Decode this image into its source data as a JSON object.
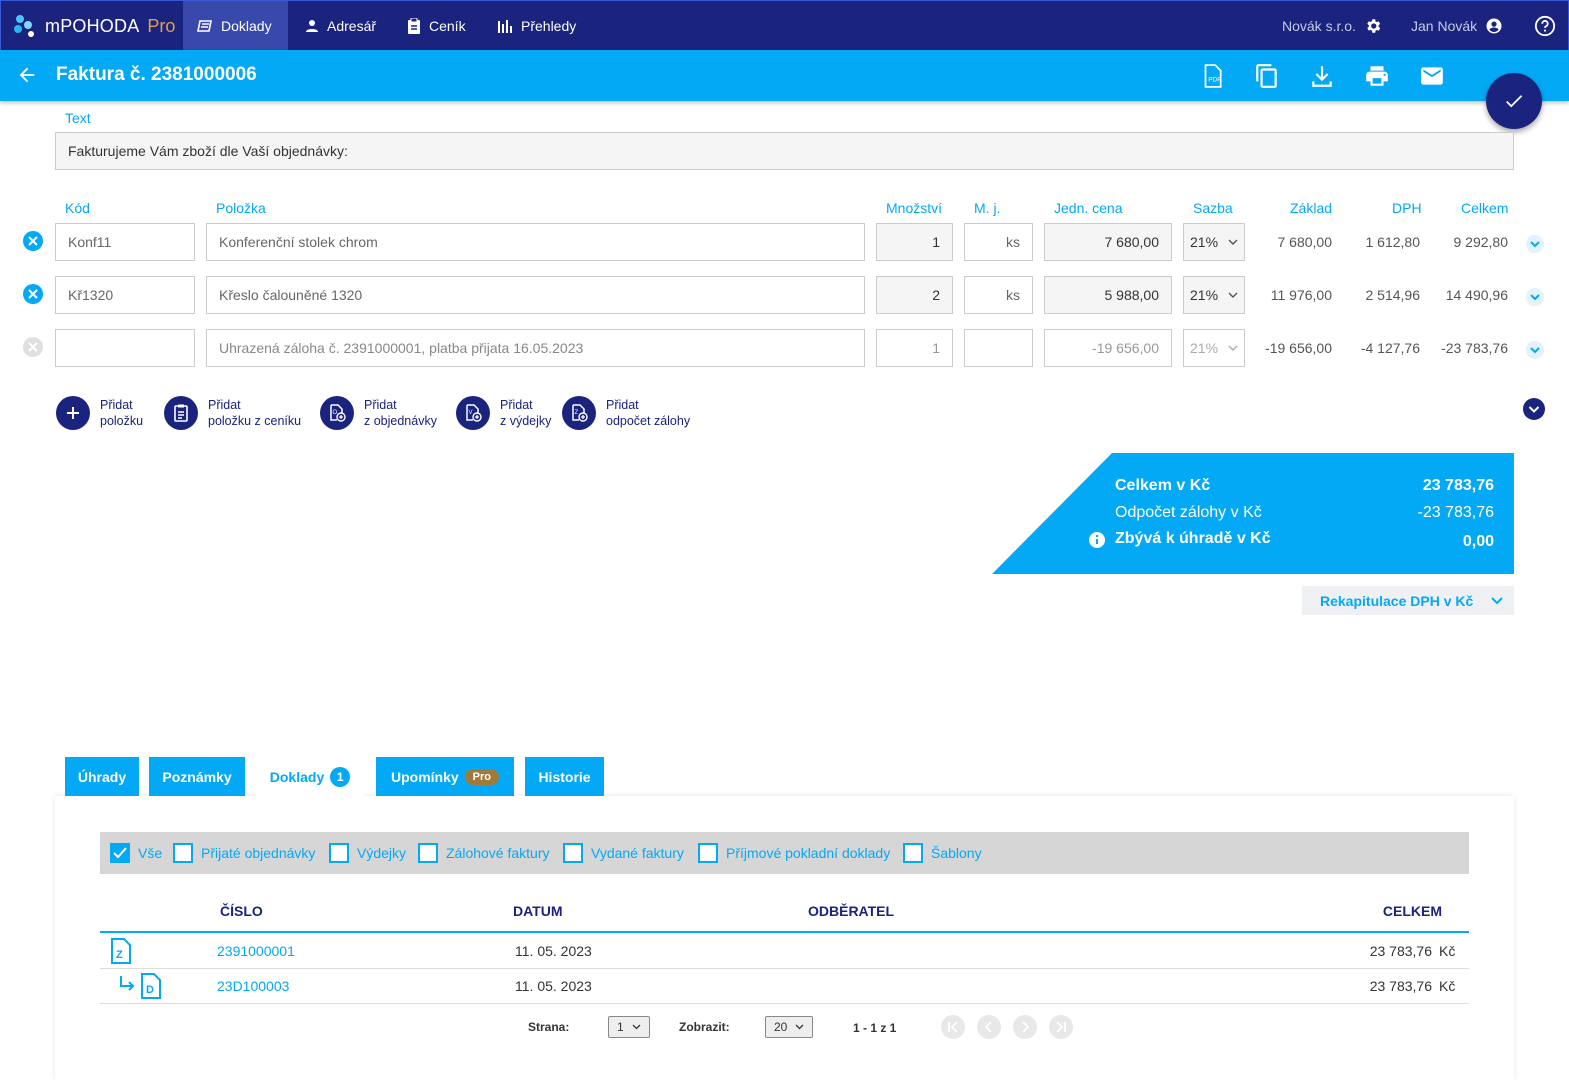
{
  "app": {
    "brand": "mPOHODA",
    "brand_suffix": "Pro"
  },
  "nav": {
    "items": [
      {
        "label": "Doklady",
        "icon": "stack-icon"
      },
      {
        "label": "Adresář",
        "icon": "person-icon"
      },
      {
        "label": "Ceník",
        "icon": "clipboard-icon"
      },
      {
        "label": "Přehledy",
        "icon": "bar-chart-icon"
      }
    ]
  },
  "account": {
    "company": "Novák s.r.o.",
    "user": "Jan Novák"
  },
  "titlebar": {
    "title": "Faktura č. 2381000006"
  },
  "text_field": {
    "label": "Text",
    "value": "Fakturujeme Vám zboží dle Vaší objednávky:"
  },
  "columns": {
    "kod": "Kód",
    "polozka": "Položka",
    "mnozstvi": "Množství",
    "mj": "M. j.",
    "cena": "Jedn. cena",
    "sazba": "Sazba",
    "zaklad": "Základ",
    "dph": "DPH",
    "celkem": "Celkem"
  },
  "rows": [
    {
      "kod": "Konf11",
      "polozka": "Konferenční stolek chrom",
      "mnozstvi": "1",
      "mj": "ks",
      "cena": "7 680,00",
      "sazba": "21%",
      "zaklad": "7 680,00",
      "dph": "1 612,80",
      "celkem": "9 292,80"
    },
    {
      "kod": "Kř1320",
      "polozka": "Křeslo čalouněné 1320",
      "mnozstvi": "2",
      "mj": "ks",
      "cena": "5 988,00",
      "sazba": "21%",
      "zaklad": "11 976,00",
      "dph": "2 514,96",
      "celkem": "14 490,96"
    },
    {
      "kod": "",
      "polozka": "Uhrazená záloha č. 2391000001, platba přijata 16.05.2023",
      "mnozstvi": "1",
      "mj": "",
      "cena": "-19 656,00",
      "sazba": "21%",
      "zaklad": "-19 656,00",
      "dph": "-4 127,76",
      "celkem": "-23 783,76"
    }
  ],
  "add_buttons": [
    {
      "line1": "Přidat",
      "line2": "položku"
    },
    {
      "line1": "Přidat",
      "line2": "položku z ceníku"
    },
    {
      "line1": "Přidat",
      "line2": "z objednávky"
    },
    {
      "line1": "Přidat",
      "line2": "z výdejky"
    },
    {
      "line1": "Přidat",
      "line2": "odpočet zálohy"
    }
  ],
  "totals": {
    "celkem_label": "Celkem v Kč",
    "celkem": "23 783,76",
    "odpocet_label": "Odpočet zálohy v Kč",
    "odpocet": "-23 783,76",
    "zbyva_label": "Zbývá k úhradě v Kč",
    "zbyva": "0,00"
  },
  "recap": {
    "label": "Rekapitulace DPH v Kč"
  },
  "tabs": [
    {
      "label": "Úhrady"
    },
    {
      "label": "Poznámky"
    },
    {
      "label": "Doklady",
      "badge": "1"
    },
    {
      "label": "Upomínky",
      "badge": "Pro"
    },
    {
      "label": "Historie"
    }
  ],
  "filters": [
    {
      "label": "Vše",
      "checked": true
    },
    {
      "label": "Přijaté objednávky",
      "checked": false
    },
    {
      "label": "Výdejky",
      "checked": false
    },
    {
      "label": "Zálohové faktury",
      "checked": false
    },
    {
      "label": "Vydané faktury",
      "checked": false
    },
    {
      "label": "Příjmové pokladní doklady",
      "checked": false
    },
    {
      "label": "Šablony",
      "checked": false
    }
  ],
  "doc_table": {
    "headers": {
      "cislo": "ČÍSLO",
      "datum": "DATUM",
      "odberatel": "ODBĚRATEL",
      "celkem": "CELKEM"
    },
    "rows": [
      {
        "icon": "Z",
        "cislo": "2391000001",
        "datum": "11. 05. 2023",
        "odberatel": "",
        "celkem": "23 783,76",
        "mena": "Kč"
      },
      {
        "icon": "D",
        "cislo": "23D100003",
        "datum": "11. 05. 2023",
        "odberatel": "",
        "celkem": "23 783,76",
        "mena": "Kč"
      }
    ]
  },
  "pagination": {
    "strana_label": "Strana:",
    "strana": "1",
    "zobrazit_label": "Zobrazit:",
    "zobrazit": "20",
    "range": "1 - 1 z 1"
  }
}
